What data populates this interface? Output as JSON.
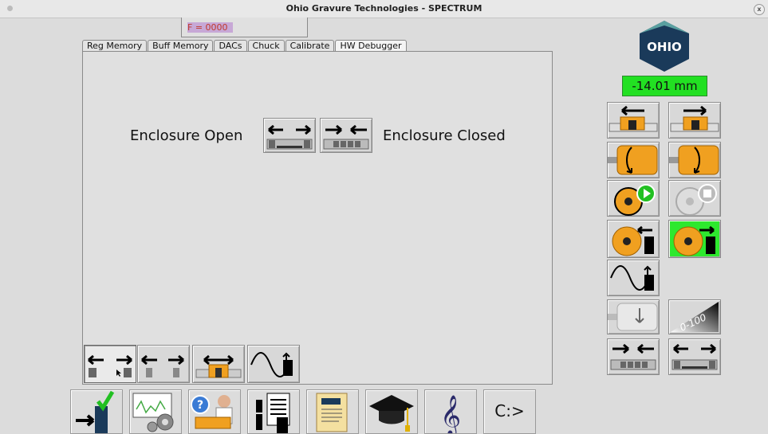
{
  "window": {
    "title": "Ohio Gravure Technologies - SPECTRUM",
    "close_glyph": "x"
  },
  "status": {
    "f_value": "F = 0000"
  },
  "tabs": [
    {
      "label": "Reg Memory"
    },
    {
      "label": "Buff Memory"
    },
    {
      "label": "DACs"
    },
    {
      "label": "Chuck"
    },
    {
      "label": "Calibrate"
    },
    {
      "label": "HW Debugger",
      "active": true
    }
  ],
  "enclosure": {
    "open_label": "Enclosure Open",
    "closed_label": "Enclosure Closed"
  },
  "logo": {
    "text": "OHIO"
  },
  "position": {
    "readout": "-14.01 mm"
  },
  "calibration_label": "0-100",
  "bottom_bar": {
    "console_label": "C:>"
  },
  "colors": {
    "accent_green": "#22e022",
    "orange": "#f0a020",
    "logo_blue": "#1a3a5a",
    "f_value_red": "#c0392b"
  }
}
